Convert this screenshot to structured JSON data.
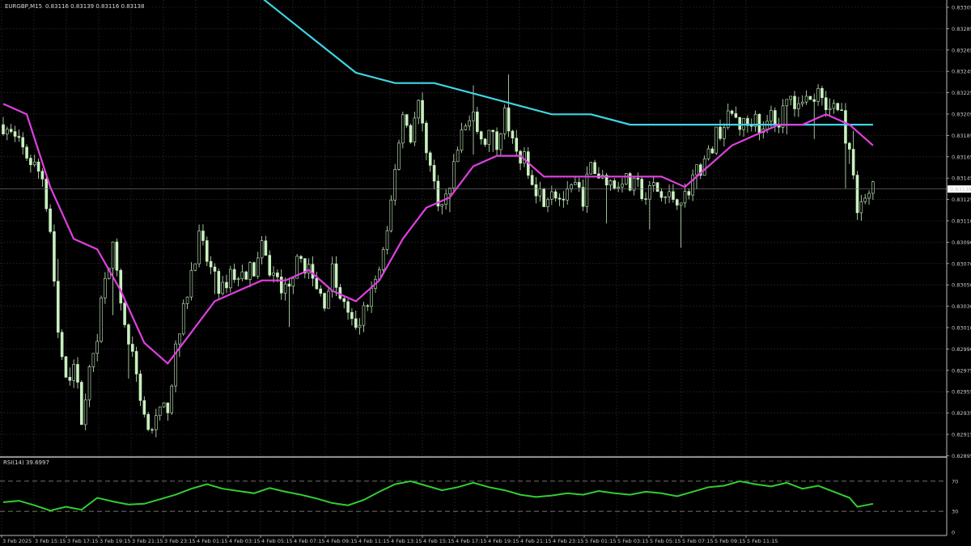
{
  "header": {
    "symbol": "EURGBP,M15",
    "ohlc": "0.83116 0.83139 0.83116 0.83138"
  },
  "rsi_header": "RSI(14) 39.6997",
  "current_price": "0.83138",
  "colors": {
    "background": "#000000",
    "grid": "#2e2e2e",
    "bull_candle": "#000000",
    "candle_outline": "#c9f0c0",
    "ma_fast": "#e040e0",
    "ma_slow": "#3fd5e3",
    "rsi_line": "#32cd32",
    "axis_text": "#c8c8c8",
    "price_tag_bg": "#ffffff",
    "price_tag_text": "#000000"
  },
  "chart_data": [
    {
      "type": "candlestick",
      "ylim": [
        0.8288,
        0.8332
      ],
      "y_ticks": [
        "0.83305",
        "0.83285",
        "0.83265",
        "0.83245",
        "0.83225",
        "0.83205",
        "0.83185",
        "0.83165",
        "0.83145",
        "0.83125",
        "0.83110",
        "0.83090",
        "0.83070",
        "0.83050",
        "0.83030",
        "0.83010",
        "0.82990",
        "0.82975",
        "0.82955",
        "0.82935",
        "0.82915",
        "0.82895"
      ],
      "x_ticks": [
        "3 Feb 2025",
        "3 Feb 15:15",
        "3 Feb 17:15",
        "3 Feb 19:15",
        "3 Feb 21:15",
        "3 Feb 23:15",
        "4 Feb 01:15",
        "4 Feb 03:15",
        "4 Feb 05:15",
        "4 Feb 07:15",
        "4 Feb 09:15",
        "4 Feb 11:15",
        "4 Feb 13:15",
        "4 Feb 15:15",
        "4 Feb 17:15",
        "4 Feb 19:15",
        "4 Feb 21:15",
        "4 Feb 23:15",
        "5 Feb 01:15",
        "5 Feb 03:15",
        "5 Feb 05:15",
        "5 Feb 07:15",
        "5 Feb 09:15",
        "5 Feb 11:15"
      ],
      "close_path": [
        [
          0,
          0.832
        ],
        [
          4,
          0.8318
        ],
        [
          8,
          0.8316
        ],
        [
          10,
          0.8315
        ],
        [
          12,
          0.831
        ],
        [
          14,
          0.83
        ],
        [
          16,
          0.8295
        ],
        [
          18,
          0.8297
        ],
        [
          20,
          0.8292
        ],
        [
          22,
          0.8296
        ],
        [
          24,
          0.83
        ],
        [
          26,
          0.8306
        ],
        [
          28,
          0.8308
        ],
        [
          30,
          0.8303
        ],
        [
          32,
          0.8299
        ],
        [
          34,
          0.8296
        ],
        [
          36,
          0.8292
        ],
        [
          38,
          0.8291
        ],
        [
          40,
          0.8292
        ],
        [
          42,
          0.8293
        ],
        [
          44,
          0.8298
        ],
        [
          46,
          0.8302
        ],
        [
          48,
          0.8306
        ],
        [
          50,
          0.8309
        ],
        [
          52,
          0.8307
        ],
        [
          54,
          0.8305
        ],
        [
          56,
          0.8304
        ],
        [
          58,
          0.8306
        ],
        [
          60,
          0.8305
        ],
        [
          62,
          0.8306
        ],
        [
          64,
          0.8306
        ],
        [
          66,
          0.8308
        ],
        [
          68,
          0.8306
        ],
        [
          70,
          0.8305
        ],
        [
          72,
          0.8304
        ],
        [
          74,
          0.8306
        ],
        [
          76,
          0.8307
        ],
        [
          78,
          0.8306
        ],
        [
          80,
          0.8304
        ],
        [
          82,
          0.8303
        ],
        [
          84,
          0.8306
        ],
        [
          86,
          0.8303
        ],
        [
          88,
          0.8302
        ],
        [
          90,
          0.83
        ],
        [
          92,
          0.8302
        ],
        [
          94,
          0.8304
        ],
        [
          96,
          0.8306
        ],
        [
          98,
          0.8309
        ],
        [
          100,
          0.8316
        ],
        [
          102,
          0.8321
        ],
        [
          104,
          0.8319
        ],
        [
          106,
          0.8322
        ],
        [
          108,
          0.8318
        ],
        [
          110,
          0.8314
        ],
        [
          112,
          0.8312
        ],
        [
          114,
          0.8314
        ],
        [
          116,
          0.8318
        ],
        [
          118,
          0.832
        ],
        [
          120,
          0.8321
        ],
        [
          122,
          0.8318
        ],
        [
          124,
          0.8319
        ],
        [
          126,
          0.8318
        ],
        [
          128,
          0.8322
        ],
        [
          130,
          0.8318
        ],
        [
          132,
          0.8317
        ],
        [
          134,
          0.8316
        ],
        [
          136,
          0.8314
        ],
        [
          138,
          0.8313
        ],
        [
          140,
          0.8314
        ],
        [
          142,
          0.8313
        ],
        [
          144,
          0.8313
        ],
        [
          146,
          0.8314
        ],
        [
          148,
          0.8313
        ],
        [
          150,
          0.8316
        ],
        [
          152,
          0.8315
        ],
        [
          154,
          0.8315
        ],
        [
          156,
          0.8314
        ],
        [
          158,
          0.8315
        ],
        [
          160,
          0.8314
        ],
        [
          162,
          0.8314
        ],
        [
          164,
          0.8313
        ],
        [
          166,
          0.8314
        ],
        [
          168,
          0.8313
        ],
        [
          170,
          0.8313
        ],
        [
          172,
          0.8313
        ],
        [
          174,
          0.8313
        ],
        [
          176,
          0.8315
        ],
        [
          178,
          0.8316
        ],
        [
          180,
          0.8317
        ],
        [
          182,
          0.8319
        ],
        [
          184,
          0.832
        ],
        [
          186,
          0.8321
        ],
        [
          188,
          0.832
        ],
        [
          190,
          0.832
        ],
        [
          192,
          0.8321
        ],
        [
          194,
          0.8319
        ],
        [
          196,
          0.8321
        ],
        [
          198,
          0.832
        ],
        [
          200,
          0.8323
        ],
        [
          202,
          0.8322
        ],
        [
          204,
          0.8323
        ],
        [
          206,
          0.8322
        ],
        [
          208,
          0.8323
        ],
        [
          210,
          0.8321
        ],
        [
          212,
          0.8322
        ],
        [
          214,
          0.8321
        ],
        [
          216,
          0.8317
        ],
        [
          218,
          0.8312
        ],
        [
          220,
          0.8313
        ],
        [
          222,
          0.83138
        ]
      ],
      "series": [
        {
          "values": [
            [
              0,
              0.8322
            ],
            [
              6,
              0.8321
            ],
            [
              12,
              0.8314
            ],
            [
              18,
              0.8309
            ],
            [
              24,
              0.8308
            ],
            [
              30,
              0.8304
            ],
            [
              36,
              0.8299
            ],
            [
              42,
              0.8297
            ],
            [
              48,
              0.83
            ],
            [
              54,
              0.8303
            ],
            [
              60,
              0.8304
            ],
            [
              66,
              0.8305
            ],
            [
              72,
              0.8305
            ],
            [
              78,
              0.8306
            ],
            [
              84,
              0.8304
            ],
            [
              90,
              0.8303
            ],
            [
              96,
              0.8305
            ],
            [
              102,
              0.8309
            ],
            [
              108,
              0.8312
            ],
            [
              114,
              0.8313
            ],
            [
              120,
              0.8316
            ],
            [
              126,
              0.8317
            ],
            [
              132,
              0.8317
            ],
            [
              138,
              0.8315
            ],
            [
              144,
              0.8315
            ],
            [
              150,
              0.8315
            ],
            [
              156,
              0.8315
            ],
            [
              162,
              0.8315
            ],
            [
              168,
              0.8315
            ],
            [
              174,
              0.8314
            ],
            [
              180,
              0.8316
            ],
            [
              186,
              0.8318
            ],
            [
              192,
              0.8319
            ],
            [
              198,
              0.832
            ],
            [
              204,
              0.832
            ],
            [
              210,
              0.8321
            ],
            [
              216,
              0.832
            ],
            [
              222,
              0.8318
            ]
          ]
        },
        {
          "values": [
            [
              60,
              0.8334
            ],
            [
              70,
              0.8331
            ],
            [
              80,
              0.8328
            ],
            [
              90,
              0.8325
            ],
            [
              100,
              0.8324
            ],
            [
              110,
              0.8324
            ],
            [
              120,
              0.8323
            ],
            [
              130,
              0.8322
            ],
            [
              140,
              0.8321
            ],
            [
              150,
              0.8321
            ],
            [
              160,
              0.832
            ],
            [
              170,
              0.832
            ],
            [
              180,
              0.832
            ],
            [
              190,
              0.832
            ],
            [
              200,
              0.832
            ],
            [
              210,
              0.832
            ],
            [
              220,
              0.832
            ],
            [
              222,
              0.832
            ]
          ]
        }
      ]
    },
    {
      "type": "line",
      "ylim": [
        0,
        100
      ],
      "y_ticks": [
        70,
        30,
        0
      ],
      "levels": [
        70,
        30
      ],
      "series": [
        {
          "values": [
            [
              0,
              42
            ],
            [
              4,
              44
            ],
            [
              8,
              38
            ],
            [
              12,
              31
            ],
            [
              16,
              36
            ],
            [
              20,
              32
            ],
            [
              24,
              48
            ],
            [
              28,
              43
            ],
            [
              32,
              39
            ],
            [
              36,
              40
            ],
            [
              40,
              46
            ],
            [
              44,
              52
            ],
            [
              48,
              60
            ],
            [
              52,
              66
            ],
            [
              56,
              60
            ],
            [
              60,
              57
            ],
            [
              64,
              54
            ],
            [
              68,
              61
            ],
            [
              72,
              56
            ],
            [
              76,
              52
            ],
            [
              80,
              47
            ],
            [
              84,
              41
            ],
            [
              88,
              38
            ],
            [
              92,
              45
            ],
            [
              96,
              56
            ],
            [
              100,
              66
            ],
            [
              104,
              70
            ],
            [
              108,
              64
            ],
            [
              112,
              58
            ],
            [
              116,
              62
            ],
            [
              120,
              68
            ],
            [
              124,
              62
            ],
            [
              128,
              58
            ],
            [
              132,
              52
            ],
            [
              136,
              49
            ],
            [
              140,
              51
            ],
            [
              144,
              54
            ],
            [
              148,
              52
            ],
            [
              152,
              57
            ],
            [
              156,
              54
            ],
            [
              160,
              52
            ],
            [
              164,
              56
            ],
            [
              168,
              54
            ],
            [
              172,
              50
            ],
            [
              176,
              56
            ],
            [
              180,
              62
            ],
            [
              184,
              64
            ],
            [
              188,
              70
            ],
            [
              192,
              66
            ],
            [
              196,
              63
            ],
            [
              200,
              68
            ],
            [
              204,
              60
            ],
            [
              208,
              64
            ],
            [
              212,
              56
            ],
            [
              216,
              48
            ],
            [
              218,
              36
            ],
            [
              220,
              38
            ],
            [
              222,
              40
            ]
          ]
        }
      ]
    }
  ]
}
